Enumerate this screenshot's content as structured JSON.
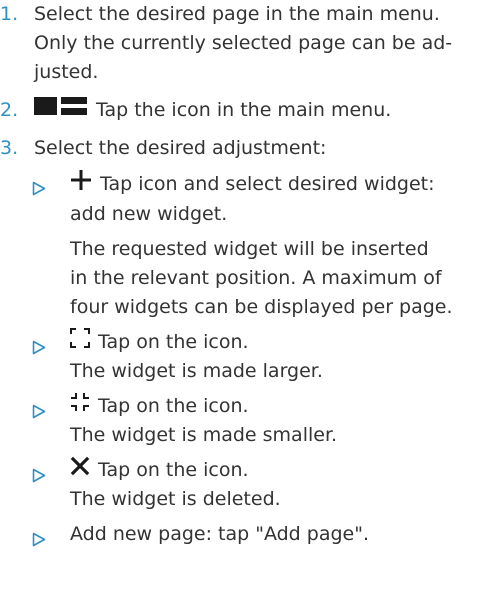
{
  "steps": [
    {
      "number": "1.",
      "lines": [
        "Select the desired page in the main menu.",
        "Only the currently selected page can be ad-",
        "justed."
      ]
    },
    {
      "number": "2.",
      "icon": "layout-edit-icon",
      "text": "Tap the icon in the main menu."
    },
    {
      "number": "3.",
      "text": "Select the desired adjustment:"
    }
  ],
  "adjustments": [
    {
      "icon": "plus-icon",
      "lines": [
        "Tap icon and select desired widget:",
        "add new widget."
      ],
      "result_lines": [
        "The requested widget will be inserted",
        "in the relevant position. A maximum of",
        "four widgets can be displayed per page."
      ]
    },
    {
      "icon": "enlarge-icon",
      "text": "Tap on the icon.",
      "result": "The widget is made larger."
    },
    {
      "icon": "shrink-icon",
      "text": "Tap on the icon.",
      "result": "The widget is made smaller."
    },
    {
      "icon": "close-x-icon",
      "text": "Tap on the icon.",
      "result": "The widget is deleted."
    },
    {
      "text": "Add new page: tap \"Add page\"."
    }
  ],
  "colors": {
    "accent": "#2f90c4",
    "text": "#333333",
    "icon": "#1a1a1a"
  }
}
